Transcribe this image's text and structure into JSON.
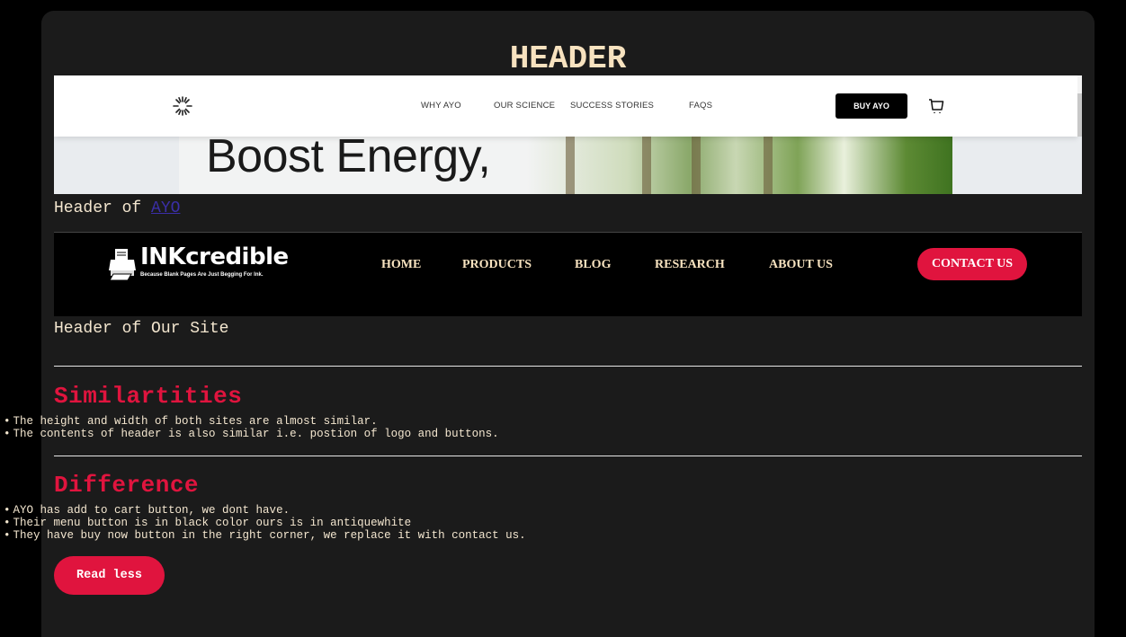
{
  "page": {
    "title": "HEADER"
  },
  "ayo": {
    "nav_links": [
      "WHY AYO",
      "OUR SCIENCE",
      "SUCCESS STORIES",
      "FAQS"
    ],
    "buy_button": "BUY AYO",
    "hero_text": "Boost Energy,",
    "logo_icon": "sunburst-logo-icon",
    "cart_icon": "cart-icon",
    "caption_prefix": "Header of ",
    "caption_link": "AYO"
  },
  "ours": {
    "brand": "INKcredible",
    "tagline": "Because Blank Pages Are Just Begging For Ink.",
    "logo_icon": "printer-icon",
    "nav_links": [
      "HOME",
      "PRODUCTS",
      "BLOG",
      "RESEARCH",
      "ABOUT US"
    ],
    "contact_button": "CONTACT US",
    "caption": "Header of Our Site"
  },
  "similarities": {
    "heading": "Similartities",
    "items": [
      "The height and width of both sites are almost similar.",
      "The contents of header is also similar i.e. postion of logo and buttons."
    ]
  },
  "difference": {
    "heading": "Difference",
    "items": [
      "AYO has add to cart button, we dont have.",
      "Their menu button is in black color ours is in antiquewhite",
      "They have buy now button in the right corner, we replace it with contact us."
    ]
  },
  "read_less_label": "Read less",
  "colors": {
    "accent": "#e0143e",
    "text": "#f3e6cf",
    "card_bg": "#1b1b1b",
    "page_bg": "#000000"
  }
}
